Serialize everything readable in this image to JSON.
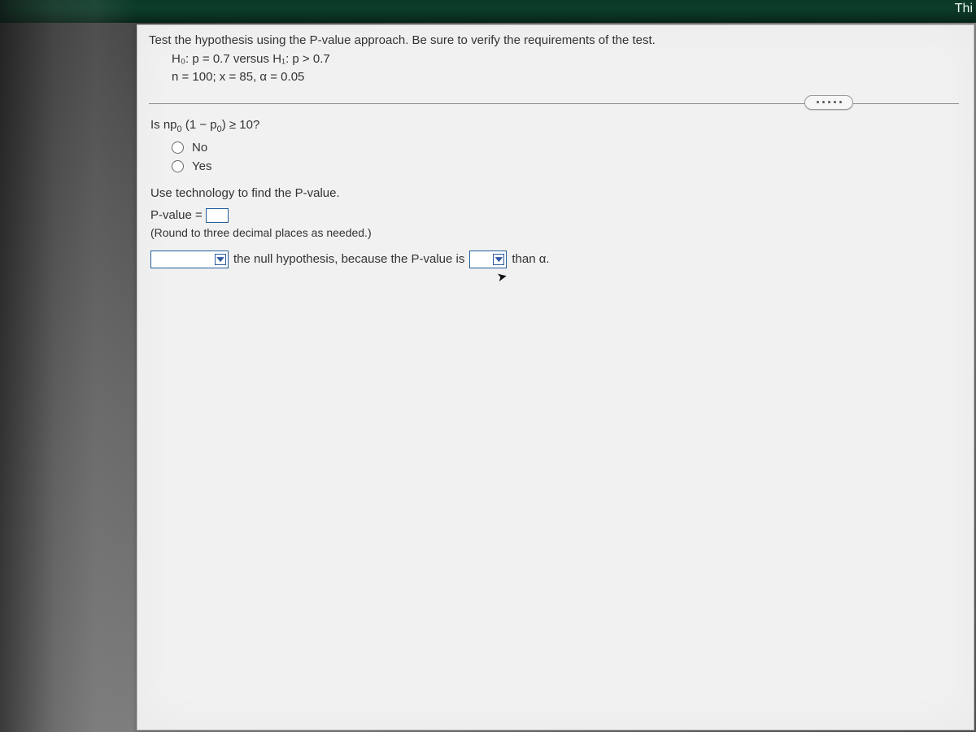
{
  "topbar": {
    "right_fragment": "Thi"
  },
  "problem": {
    "intro": "Test the hypothesis using the P-value approach. Be sure to verify the requirements of the test.",
    "hypotheses": "H₀: p = 0.7 versus H₁: p > 0.7",
    "given": "n = 100; x = 85, α = 0.05"
  },
  "requirement_q": {
    "text_prefix": "Is np",
    "text_middle": "(1 − p",
    "text_suffix": ") ≥ 10?",
    "sub": "0",
    "options": {
      "no": "No",
      "yes": "Yes"
    }
  },
  "pvalue_section": {
    "instruction": "Use technology to find the P-value.",
    "label": "P-value =",
    "value": "",
    "round_note": "(Round to three decimal places as needed.)"
  },
  "conclusion": {
    "decision_value": "",
    "mid1": "the null hypothesis, because the P-value is",
    "compare_value": "",
    "mid2": "than α."
  },
  "icons": {
    "more": "more-options"
  }
}
